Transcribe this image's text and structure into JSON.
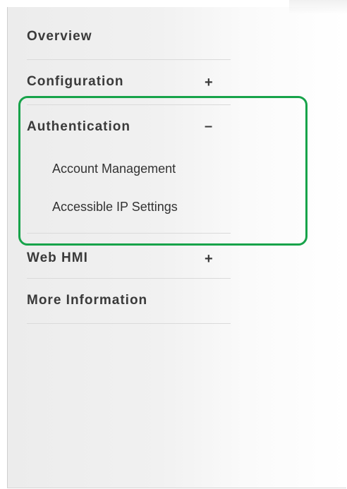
{
  "menu": {
    "overview": "Overview",
    "configuration": {
      "label": "Configuration",
      "toggle": "+"
    },
    "authentication": {
      "label": "Authentication",
      "toggle": "–",
      "subitems": [
        "Account Management",
        "Accessible IP Settings"
      ]
    },
    "web_hmi": {
      "label": "Web HMI",
      "toggle": "+"
    },
    "more_information": "More Information"
  },
  "colors": {
    "highlight": "#17a34a"
  }
}
